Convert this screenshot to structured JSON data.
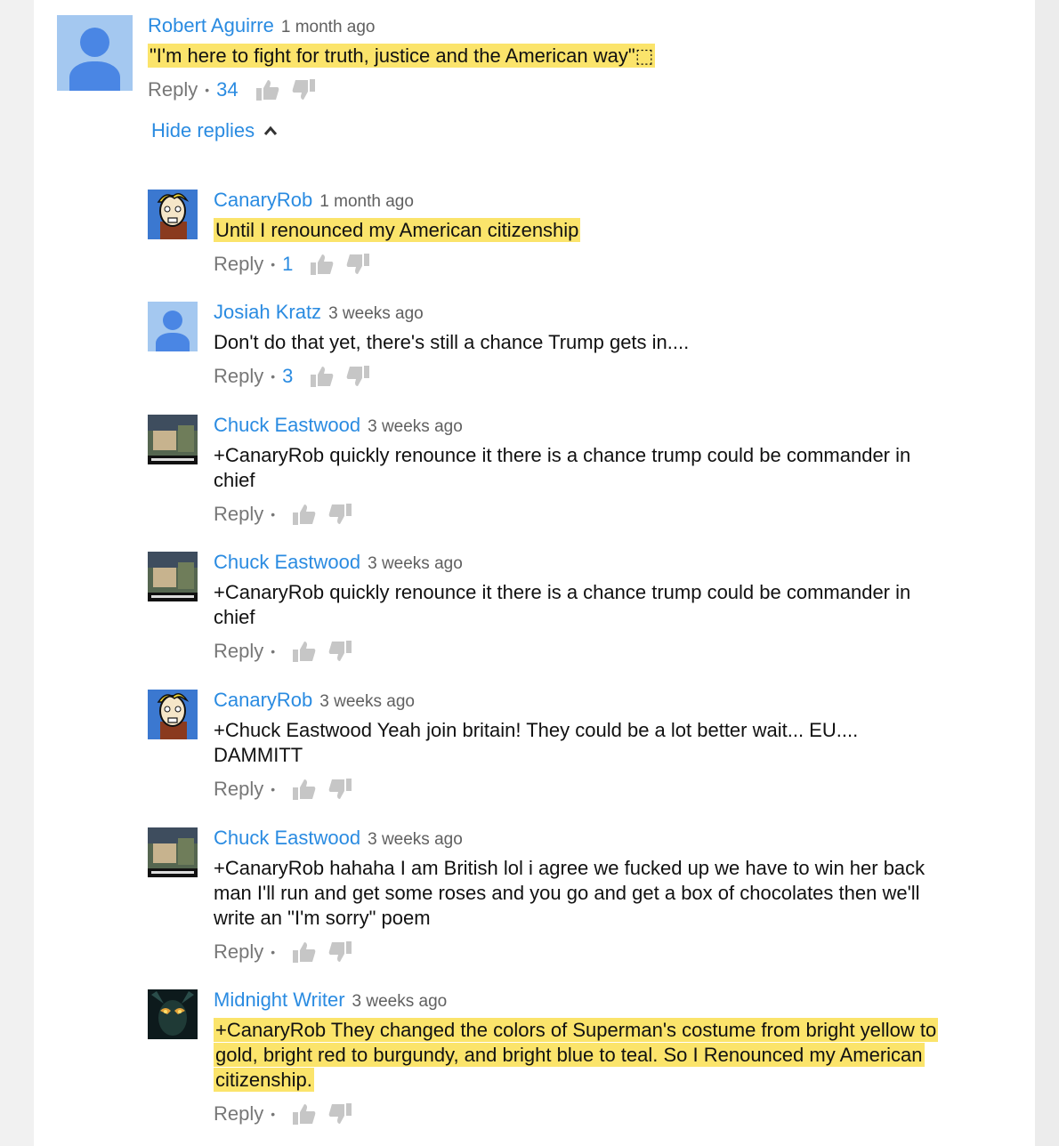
{
  "actions": {
    "reply_label": "Reply",
    "separator": "•"
  },
  "top_comment": {
    "author": "Robert Aguirre",
    "time": "1 month ago",
    "text": "\"I'm here to fight for truth, justice and the American way\"⬚",
    "likes": "34",
    "hide_replies_label": "Hide replies",
    "avatar": "default-user-icon"
  },
  "replies": [
    {
      "author": "CanaryRob",
      "time": "1 month ago",
      "text": "Until I renounced my American citizenship",
      "likes": "1",
      "highlight": true,
      "avatar": "canary-cartoon-avatar"
    },
    {
      "author": "Josiah Kratz",
      "time": "3 weeks ago",
      "text": "Don't do that yet, there's still a chance Trump gets in....",
      "likes": "3",
      "highlight": false,
      "avatar": "default-user-icon"
    },
    {
      "author": "Chuck Eastwood",
      "time": "3 weeks ago",
      "text": "+CanaryRob quickly renounce it there is a chance trump could be commander in chief",
      "likes": "",
      "highlight": false,
      "avatar": "photo-avatar"
    },
    {
      "author": "Chuck Eastwood",
      "time": "3 weeks ago",
      "text": "+CanaryRob quickly renounce it there is a chance trump could be commander in chief",
      "likes": "",
      "highlight": false,
      "avatar": "photo-avatar"
    },
    {
      "author": "CanaryRob",
      "time": "3 weeks ago",
      "text": "+Chuck Eastwood Yeah join britain! They could be a lot better wait... EU.... DAMMITT",
      "likes": "",
      "highlight": false,
      "avatar": "canary-cartoon-avatar"
    },
    {
      "author": "Chuck Eastwood",
      "time": "3 weeks ago",
      "text": "+CanaryRob hahaha I am British lol i agree we fucked up we have to win her back man I'll run and get some roses and you go and get a box of chocolates then we'll write an \"I'm sorry\" poem",
      "likes": "",
      "highlight": false,
      "avatar": "photo-avatar"
    },
    {
      "author": "Midnight Writer",
      "time": "3 weeks ago",
      "text": "+CanaryRob They changed the colors of Superman's costume from bright yellow to gold, bright red to burgundy, and bright blue to teal. So I Renounced my American citizenship.",
      "likes": "",
      "highlight": true,
      "avatar": "dark-fantasy-avatar"
    }
  ],
  "colors": {
    "link": "#2a8be1",
    "highlight": "#fbe46b",
    "muted": "#777777"
  }
}
